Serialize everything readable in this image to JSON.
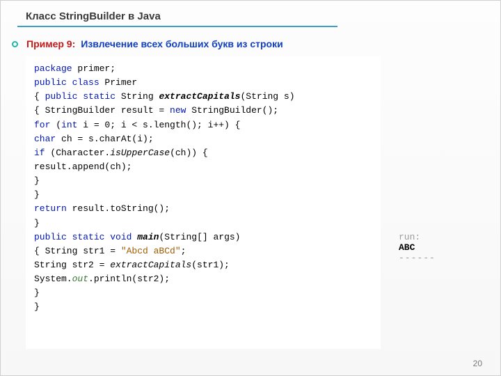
{
  "title": "Класс StringBuilder в Java",
  "example_label": "Пример 9:",
  "example_text": "Извлечение всех больших букв из строки",
  "code": {
    "l1a": "package",
    "l1b": " primer;",
    "l2a": "public class",
    "l2b": " Primer",
    "l3a": "{ ",
    "l3b": "public static",
    "l3c": " String ",
    "l3d": "extractCapitals",
    "l3e": "(String s)",
    "l4": "    { StringBuilder result = ",
    "l4a": "new",
    "l4b": " StringBuilder();",
    "l5a": "      ",
    "l5b": "for",
    "l5c": " (",
    "l5d": "int",
    "l5e": " i = 0; i < s.length(); i++) {",
    "l6a": "        ",
    "l6b": "char",
    "l6c": " ch = s.charAt(i);",
    "l7a": "          ",
    "l7b": "if",
    "l7c": " (Character.",
    "l7d": "isUpperCase",
    "l7e": "(ch)) {",
    "l8": "            result.append(ch);",
    "l9": "      }",
    "l10": "    }",
    "l11a": "  ",
    "l11b": "return",
    "l11c": " result.toString();",
    "l12": "}",
    "l13a": "  ",
    "l13b": "public static void",
    "l13c": " ",
    "l13d": "main",
    "l13e": "(String[] args)",
    "l14": "  {   String str1 = ",
    "l14a": "\"Abcd aBCd\"",
    "l14b": ";",
    "l15a": "      String str2 = ",
    "l15b": "extractCapitals",
    "l15c": "(str1);",
    "l16": "      System.",
    "l16a": "out",
    "l16b": ".println(str2);",
    "l17": "    }",
    "l18": "  }"
  },
  "output": {
    "run": "run:",
    "value": "ABC",
    "dash": "------"
  },
  "page_number": "20"
}
